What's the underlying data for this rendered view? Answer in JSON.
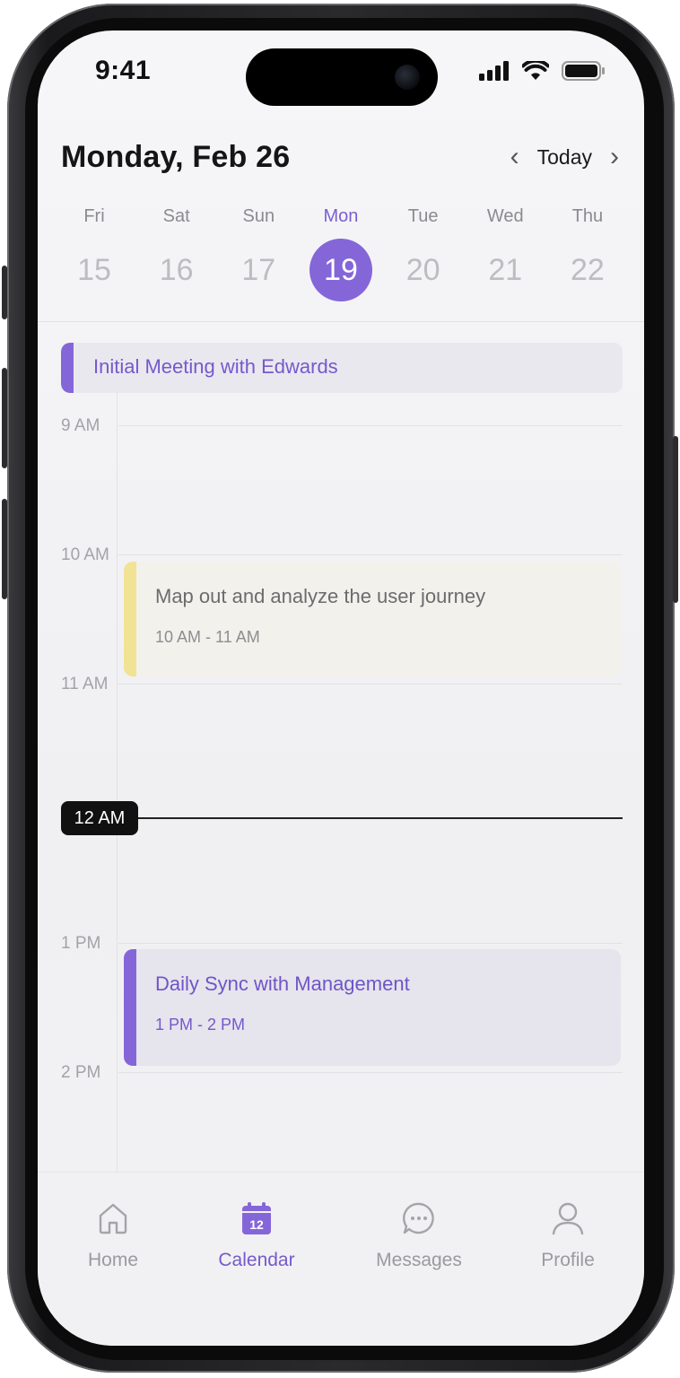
{
  "status_bar": {
    "time": "9:41"
  },
  "header": {
    "date_title": "Monday, Feb 26",
    "today_label": "Today"
  },
  "week": [
    {
      "name": "Fri",
      "num": "15",
      "active": false
    },
    {
      "name": "Sat",
      "num": "16",
      "active": false
    },
    {
      "name": "Sun",
      "num": "17",
      "active": false
    },
    {
      "name": "Mon",
      "num": "19",
      "active": true
    },
    {
      "name": "Tue",
      "num": "20",
      "active": false
    },
    {
      "name": "Wed",
      "num": "21",
      "active": false
    },
    {
      "name": "Thu",
      "num": "22",
      "active": false
    }
  ],
  "all_day_event": {
    "title": "Initial Meeting with Edwards"
  },
  "hours": [
    "9 AM",
    "10 AM",
    "11 AM",
    "1 PM",
    "2 PM"
  ],
  "current_time_label": "12 AM",
  "events": [
    {
      "title": "Map out and analyze the user journey",
      "time": "10 AM - 11 AM",
      "color": "#f1e394"
    },
    {
      "title": "Daily Sync with Management",
      "time": "1 PM - 2 PM",
      "color": "#8566d9"
    }
  ],
  "tabs": [
    {
      "label": "Home",
      "icon": "home-icon",
      "active": false
    },
    {
      "label": "Calendar",
      "icon": "calendar-icon",
      "active": true,
      "icon_text": "12"
    },
    {
      "label": "Messages",
      "icon": "message-icon",
      "active": false
    },
    {
      "label": "Profile",
      "icon": "profile-icon",
      "active": false
    }
  ],
  "colors": {
    "accent": "#8566d9",
    "accent_text": "#7659cc",
    "event_yellow": "#f1e394"
  }
}
